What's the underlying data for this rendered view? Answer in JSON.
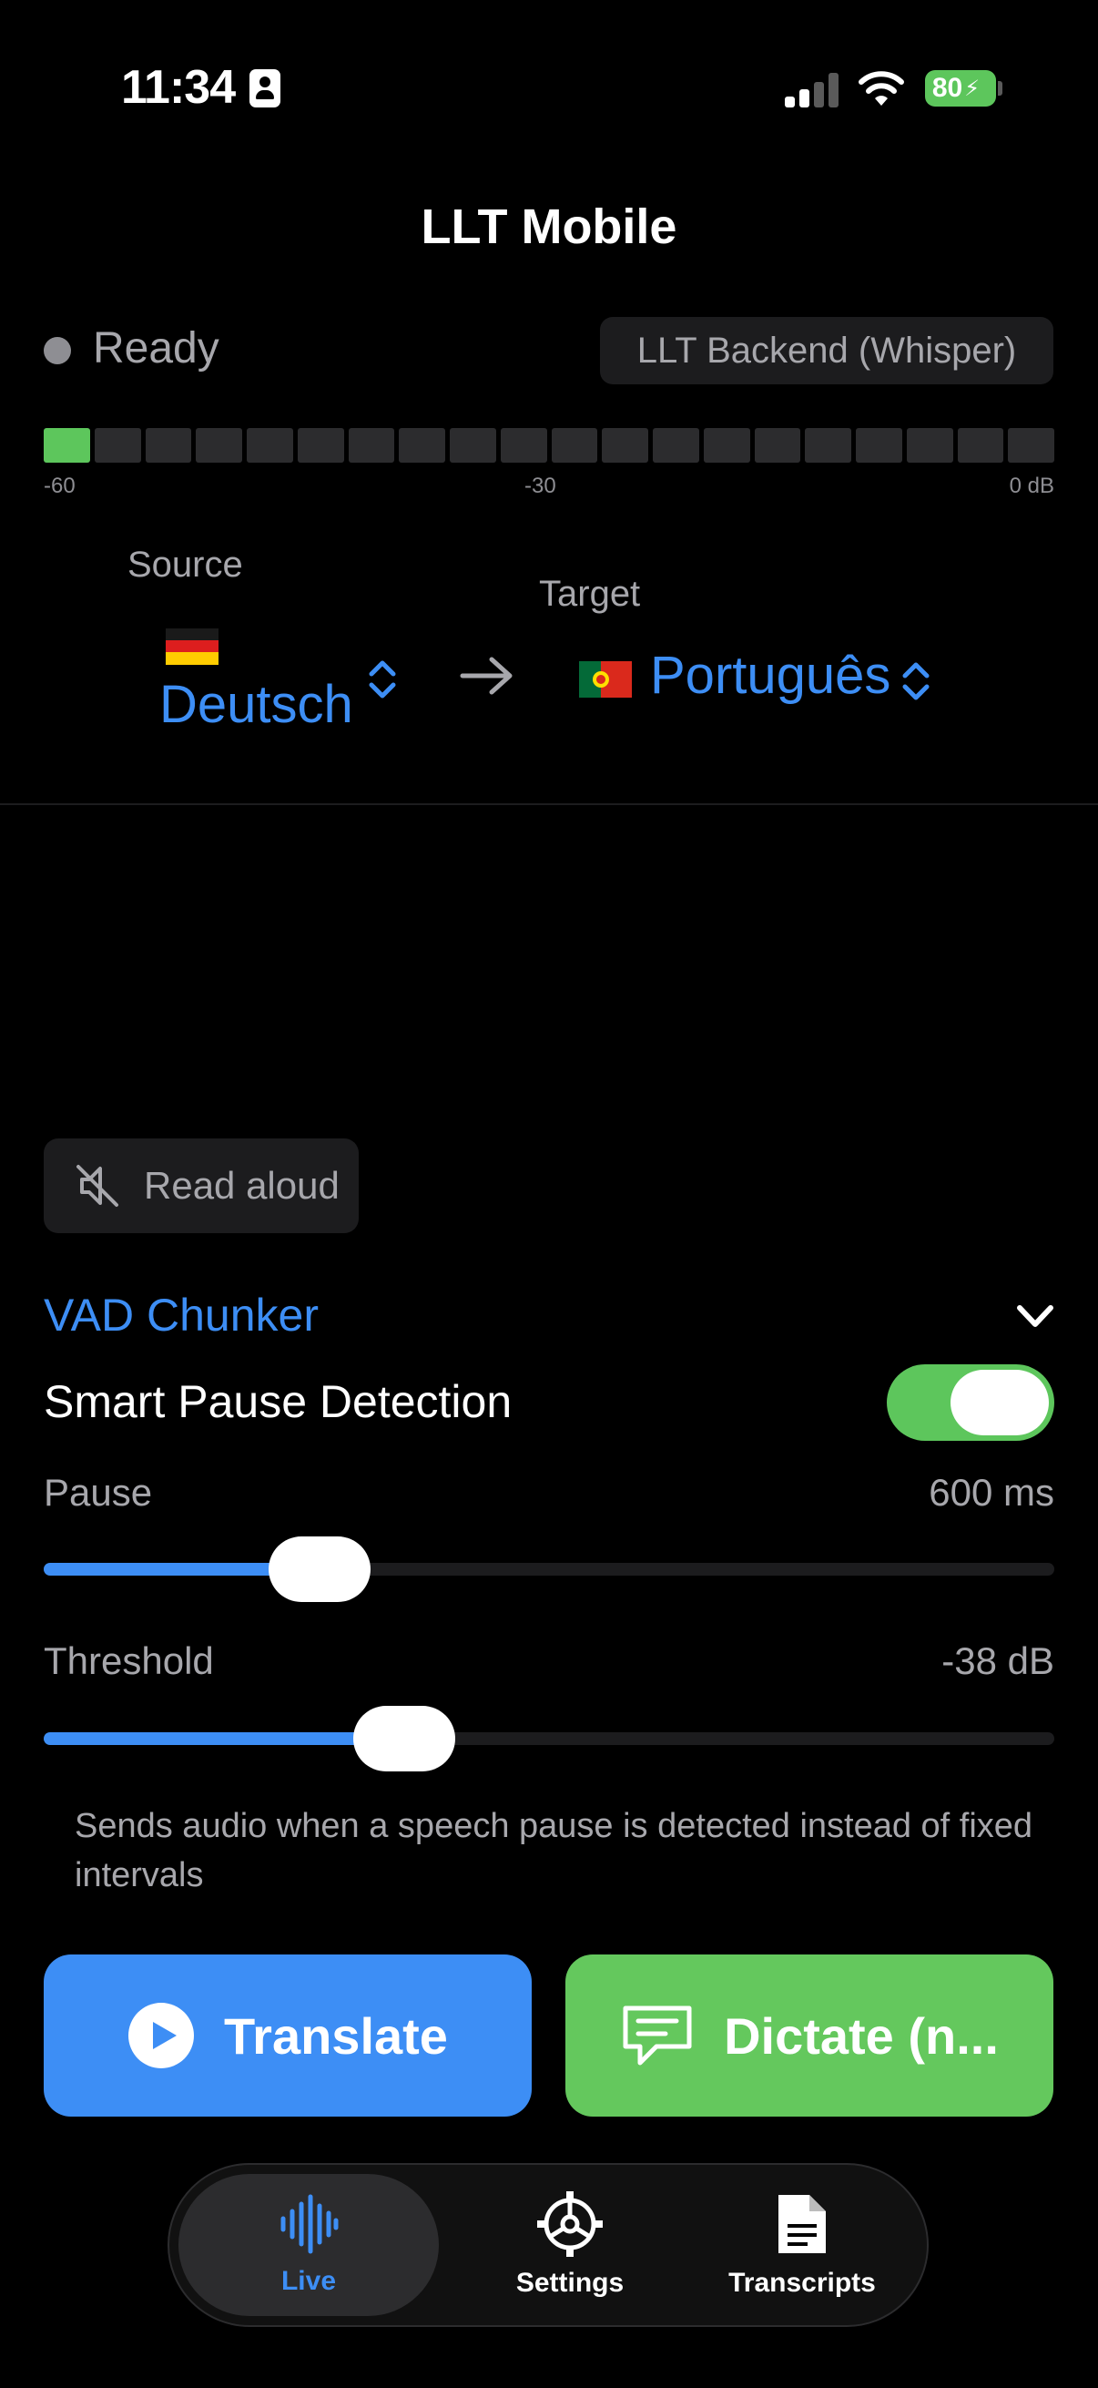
{
  "status_bar": {
    "time": "11:34",
    "battery_percent": "80"
  },
  "header": {
    "title": "LLT Mobile",
    "status": "Ready",
    "backend": "LLT Backend (Whisper)"
  },
  "meter": {
    "level_segments_on": 1,
    "total_segments": 20,
    "ticks": [
      "-60",
      "-30",
      "0 dB"
    ]
  },
  "languages": {
    "source_label": "Source",
    "source_value": "Deutsch",
    "target_label": "Target",
    "target_value": "Português"
  },
  "read_aloud": {
    "label": "Read aloud"
  },
  "vad": {
    "title": "VAD Chunker",
    "smart_pause_label": "Smart Pause Detection",
    "smart_pause_on": true,
    "pause_label": "Pause",
    "pause_value": "600 ms",
    "pause_fraction": 0.273,
    "threshold_label": "Threshold",
    "threshold_value": "-38 dB",
    "threshold_fraction": 0.357,
    "help_text": "Sends audio when a speech pause is detected instead of fixed intervals"
  },
  "actions": {
    "translate_label": "Translate",
    "dictate_label": "Dictate (n..."
  },
  "tabs": [
    {
      "label": "Live",
      "icon": "waveform-icon",
      "active": true
    },
    {
      "label": "Settings",
      "icon": "gear-icon",
      "active": false
    },
    {
      "label": "Transcripts",
      "icon": "document-icon",
      "active": false
    }
  ],
  "colors": {
    "accent": "#3d8ef5",
    "green": "#64c85d",
    "background": "#000000"
  }
}
